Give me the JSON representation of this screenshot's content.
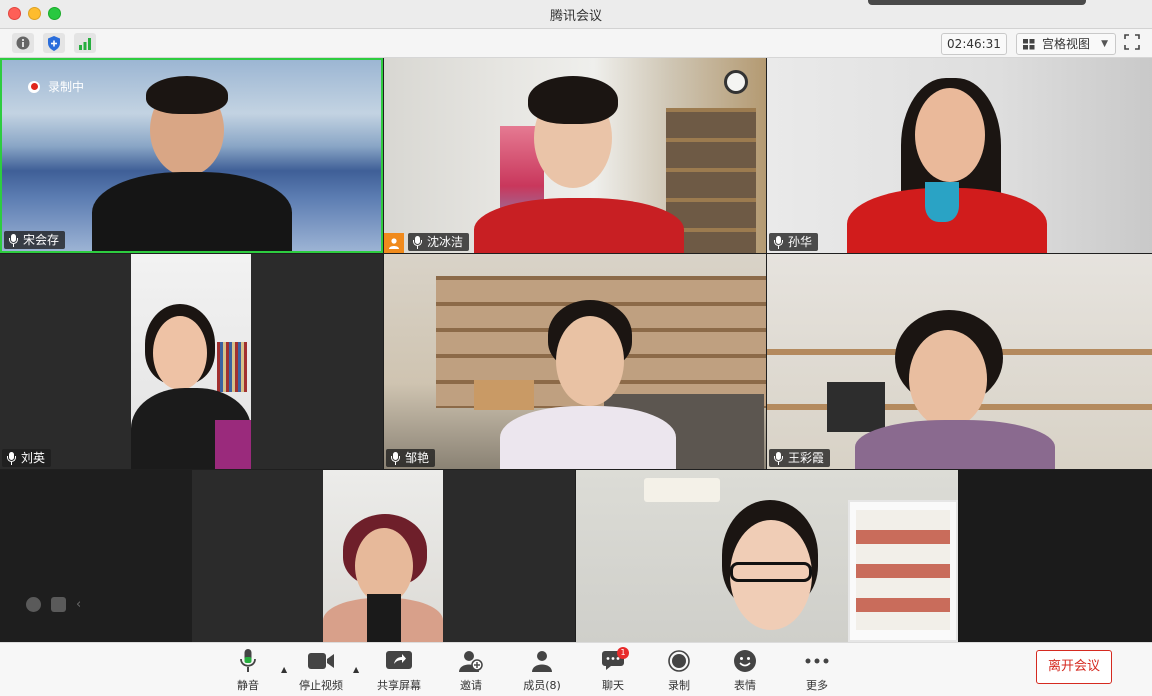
{
  "window": {
    "title": "腾讯会议"
  },
  "toolbar": {
    "timer": "02:46:31",
    "view_label": "宫格视图",
    "icons": [
      "info-icon",
      "shield-icon",
      "signal-icon",
      "fullscreen-icon"
    ]
  },
  "recording": {
    "label": "录制中"
  },
  "participants": [
    {
      "name": "宋会存"
    },
    {
      "name": "沈冰洁"
    },
    {
      "name": "孙华"
    },
    {
      "name": "刘英"
    },
    {
      "name": "邹艳"
    },
    {
      "name": "王彩霞"
    },
    {
      "name": ""
    },
    {
      "name": ""
    }
  ],
  "controls": {
    "mute": "静音",
    "stop_video": "停止视频",
    "share_screen": "共享屏幕",
    "invite": "邀请",
    "members": "成员(8)",
    "chat": "聊天",
    "chat_badge": "1",
    "record": "录制",
    "reactions": "表情",
    "more": "更多",
    "leave": "离开会议"
  },
  "colors": {
    "active_speaker_border": "#2ecc40",
    "leave": "#d52a20",
    "host_badge": "#f08a1c"
  }
}
